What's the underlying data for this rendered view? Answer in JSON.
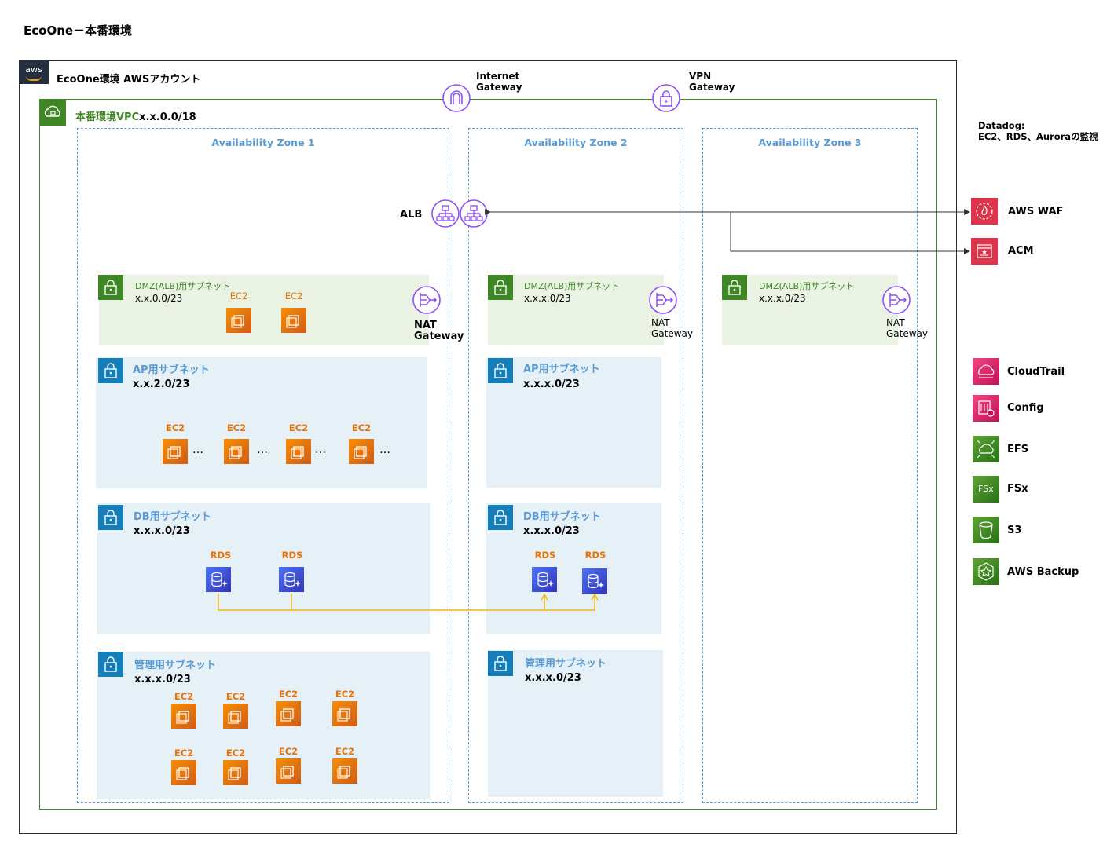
{
  "page_title": "EcoOne－本番環境",
  "account": {
    "badge": "aws",
    "label": "EcoOne環境 AWSアカウント"
  },
  "vpc": {
    "label": "本番環境VPC",
    "cidr": "x.x.0.0/18"
  },
  "gateways": {
    "internet": {
      "line1": "Internet",
      "line2": "Gateway"
    },
    "vpn": {
      "line1": "VPN",
      "line2": "Gateway"
    }
  },
  "alb_label": "ALB",
  "zones": [
    {
      "label": "Availability Zone 1"
    },
    {
      "label": "Availability Zone 2"
    },
    {
      "label": "Availability Zone 3"
    }
  ],
  "az1": {
    "dmz": {
      "title": "DMZ(ALB)用サブネット",
      "cidr": "x.x.0.0/23",
      "ec2": [
        "EC2",
        "EC2"
      ]
    },
    "nat": {
      "line1": "NAT",
      "line2": "Gateway"
    },
    "ap": {
      "title": "AP用サブネット",
      "cidr": "x.x.2.0/23",
      "ec2": [
        "EC2",
        "EC2",
        "EC2",
        "EC2"
      ],
      "ellipsis": "…"
    },
    "db": {
      "title": "DB用サブネット",
      "cidr": "x.x.x.0/23",
      "rds": [
        "RDS",
        "RDS"
      ]
    },
    "mgmt": {
      "title": "管理用サブネット",
      "cidr": "x.x.x.0/23",
      "ec2": [
        "EC2",
        "EC2",
        "EC2",
        "EC2",
        "EC2",
        "EC2",
        "EC2",
        "EC2"
      ]
    }
  },
  "az2": {
    "dmz": {
      "title": "DMZ(ALB)用サブネット",
      "cidr": "x.x.x.0/23"
    },
    "nat": {
      "line1": "NAT",
      "line2": "Gateway"
    },
    "ap": {
      "title": "AP用サブネット",
      "cidr": "x.x.x.0/23"
    },
    "db": {
      "title": "DB用サブネット",
      "cidr": "x.x.x.0/23",
      "rds": [
        "RDS",
        "RDS"
      ]
    },
    "mgmt": {
      "title": "管理用サブネット",
      "cidr": "x.x.x.0/23"
    }
  },
  "az3": {
    "dmz": {
      "title": "DMZ(ALB)用サブネット",
      "cidr": "x.x.x.0/23"
    },
    "nat": {
      "line1": "NAT",
      "line2": "Gateway"
    }
  },
  "datadog": {
    "line1": "Datadog:",
    "line2": "EC2、RDS、Auroraの監視"
  },
  "services": [
    {
      "label": "AWS WAF",
      "icon": "waf-icon",
      "color": "#dd344c"
    },
    {
      "label": "ACM",
      "icon": "acm-icon",
      "color": "#dd344c"
    },
    {
      "label": "CloudTrail",
      "icon": "cloudtrail-icon",
      "color": "#e7157b"
    },
    {
      "label": "Config",
      "icon": "config-icon",
      "color": "#e7157b"
    },
    {
      "label": "EFS",
      "icon": "efs-icon",
      "color": "#3f8624"
    },
    {
      "label": "FSx",
      "icon": "fsx-icon",
      "color": "#3f8624"
    },
    {
      "label": "S3",
      "icon": "s3-icon",
      "color": "#3f8624"
    },
    {
      "label": "AWS Backup",
      "icon": "backup-icon",
      "color": "#3f8624"
    }
  ]
}
